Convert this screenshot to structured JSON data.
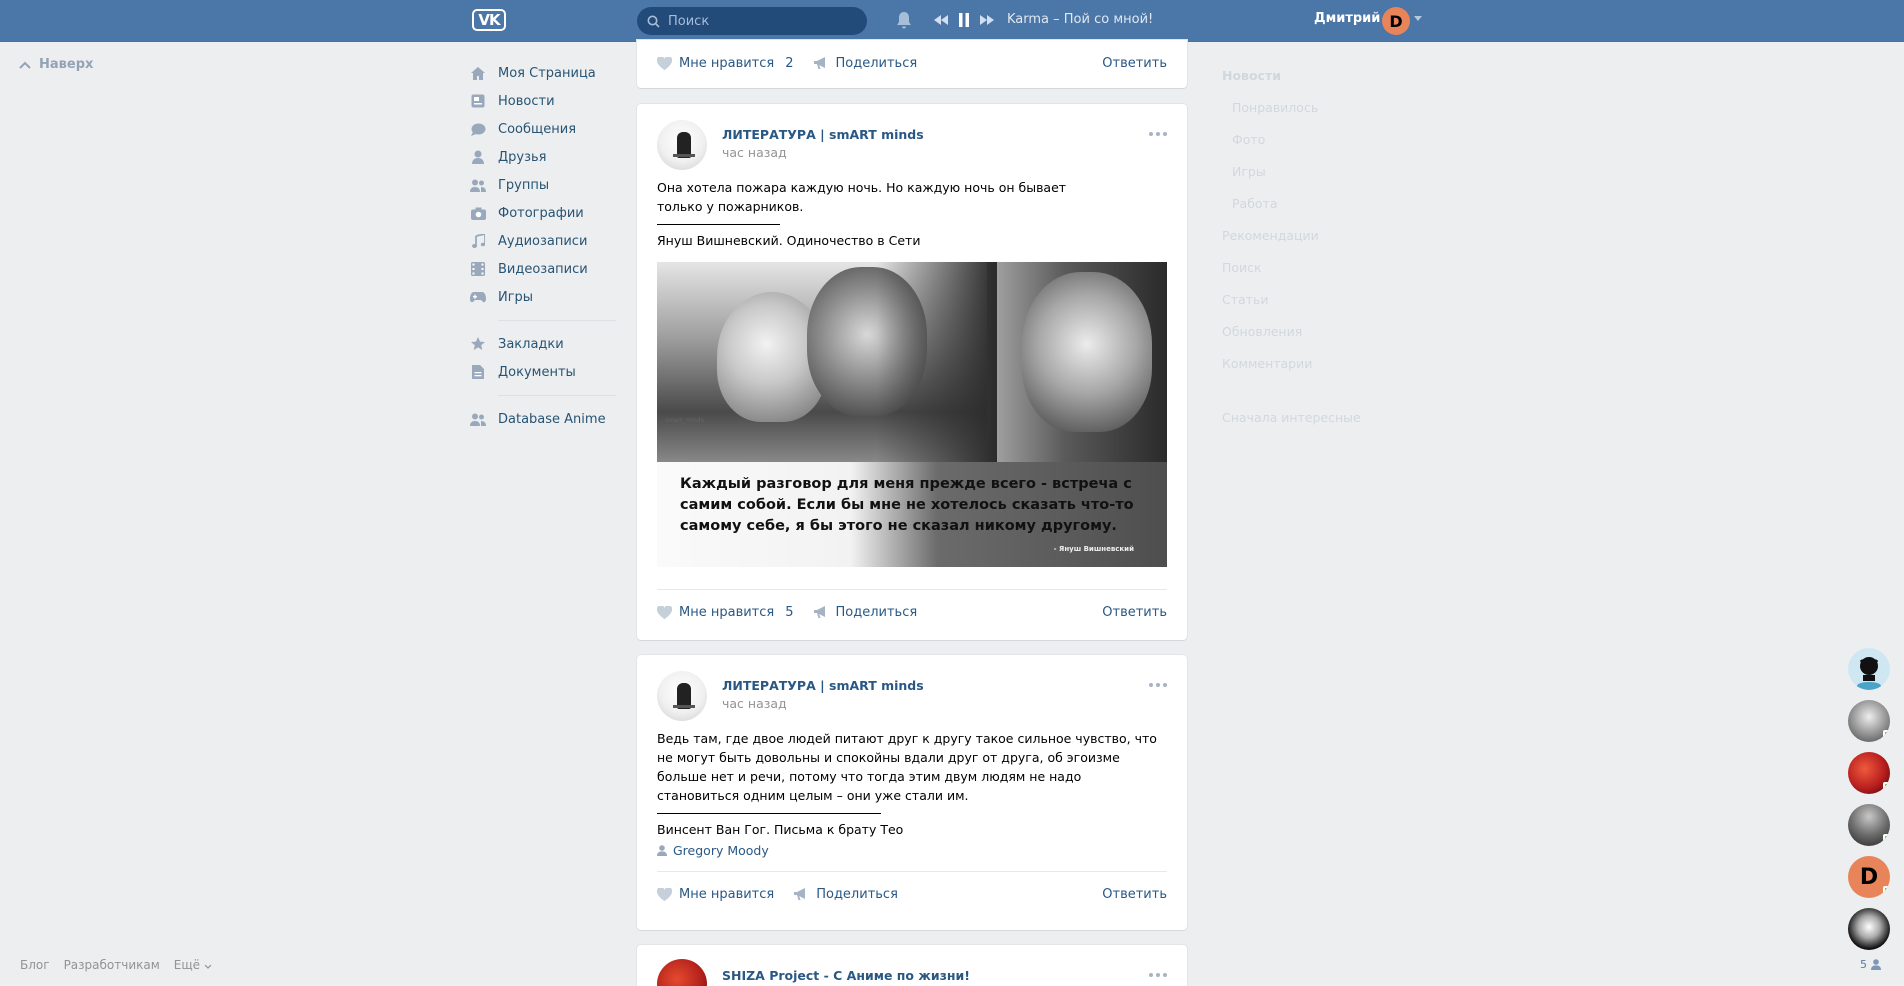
{
  "header": {
    "logo": "VK",
    "search_placeholder": "Поиск",
    "now_playing": "Karma – Пой со мной!",
    "user_name": "Дмитрий",
    "avatar_letter": "D"
  },
  "back_to_top": "Наверх",
  "nav": {
    "main": [
      "Моя Страница",
      "Новости",
      "Сообщения",
      "Друзья",
      "Группы",
      "Фотографии",
      "Аудиозаписи",
      "Видеозаписи",
      "Игры"
    ],
    "secondary": [
      "Закладки",
      "Документы"
    ],
    "apps": [
      "Database Anime"
    ]
  },
  "post0": {
    "like_label": "Мне нравится",
    "like_count": "2",
    "share_label": "Поделиться",
    "reply_label": "Ответить"
  },
  "post1": {
    "author": "ЛИТЕРАТУРА | smART minds",
    "time": "час назад",
    "text1": "Она хотела пожара каждую ночь. Но каждую ночь он бывает только у пожарников.",
    "text2": "Януш Вишневский. Одиночество в Сети",
    "image_quote": "Каждый разговор для меня прежде всего - встреча с самим собой. Если бы мне не хотелось сказать что-то самому себе, я бы этого не сказал никому другому.",
    "image_signature": "- Януш Вишневский",
    "image_watermark": "smart_minds",
    "like_label": "Мне нравится",
    "like_count": "5",
    "share_label": "Поделиться",
    "reply_label": "Ответить"
  },
  "post2": {
    "author": "ЛИТЕРАТУРА | smART minds",
    "time": "час назад",
    "text1": "Ведь там, где двое людей питают друг к другу такое сильное чувство, что не могут быть довольны и спокойны вдали друг от друга, об эгоизме больше нет и речи, потому что тогда этим двум людям не надо становиться одним целым – они уже стали им.",
    "text2": "Винсент Ван Гог. Письма к брату Тео",
    "signer": "Gregory Moody",
    "like_label": "Мне нравится",
    "share_label": "Поделиться",
    "reply_label": "Ответить"
  },
  "post3": {
    "author": "SHIZA Project - С Аниме по жизни!"
  },
  "right_menu": [
    "Новости",
    "Понравилось",
    "Фото",
    "Игры",
    "Работа",
    "Рекомендации",
    "Поиск",
    "Статьи",
    "Обновления",
    "Комментарии",
    "Сначала интересные"
  ],
  "footer": [
    "Блог",
    "Разработчикам",
    "Ещё"
  ],
  "chats": {
    "count": "5"
  },
  "colors": {
    "header": "#4a76a8",
    "link": "#2a5885",
    "bg": "#edeef0",
    "online": "#8ac176"
  }
}
